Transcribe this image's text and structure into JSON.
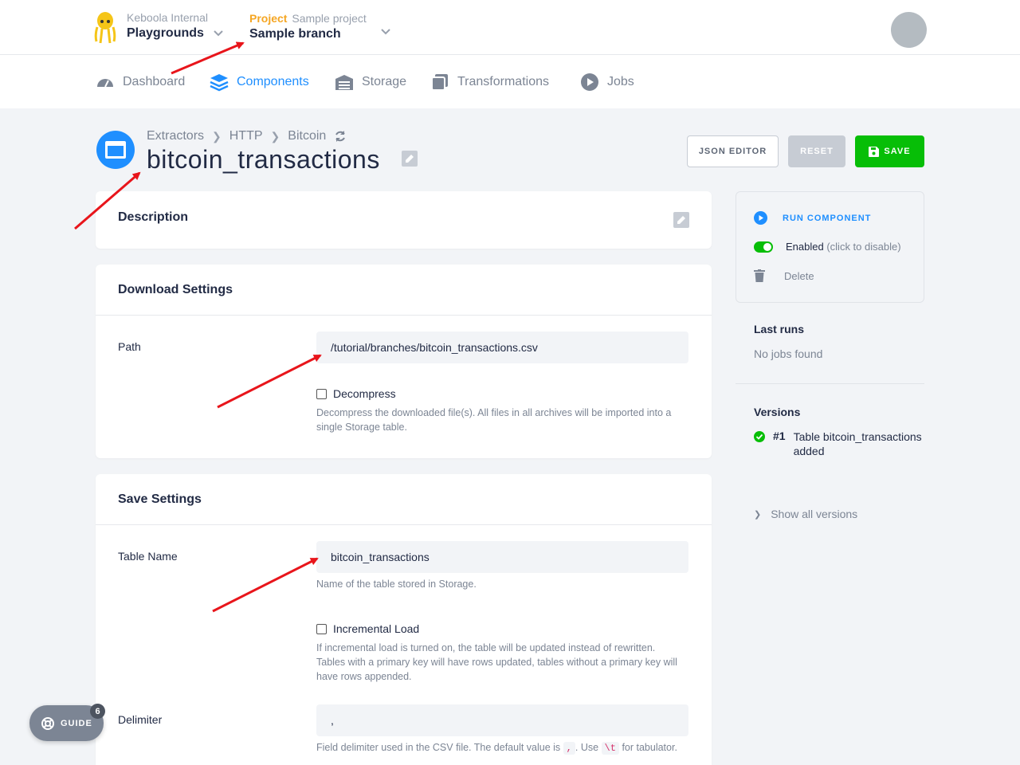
{
  "header": {
    "org_label": "Keboola Internal",
    "org_name": "Playgrounds",
    "project_prefix": "Project",
    "project_name": "Sample project",
    "branch_name": "Sample branch"
  },
  "nav": {
    "items": [
      {
        "label": "Dashboard",
        "icon": "gauge-icon"
      },
      {
        "label": "Components",
        "icon": "layers-icon"
      },
      {
        "label": "Storage",
        "icon": "warehouse-icon"
      },
      {
        "label": "Transformations",
        "icon": "copy-icon"
      },
      {
        "label": "Jobs",
        "icon": "play-circle-icon"
      }
    ],
    "active": "Components"
  },
  "page": {
    "breadcrumb": [
      "Extractors",
      "HTTP",
      "Bitcoin"
    ],
    "title": "bitcoin_transactions"
  },
  "actions": {
    "json_editor": "JSON EDITOR",
    "reset": "RESET",
    "save": "SAVE"
  },
  "description": {
    "title": "Description"
  },
  "download": {
    "title": "Download Settings",
    "path_label": "Path",
    "path_value": "/tutorial/branches/bitcoin_transactions.csv",
    "decompress_label": "Decompress",
    "decompress_help": "Decompress the downloaded file(s). All files in all archives will be imported into a single Storage table."
  },
  "save_settings": {
    "title": "Save Settings",
    "table_label": "Table Name",
    "table_value": "bitcoin_transactions",
    "table_help": "Name of the table stored in Storage.",
    "incremental_label": "Incremental Load",
    "incremental_help": "If incremental load is turned on, the table will be updated instead of rewritten. Tables with a primary key will have rows updated, tables without a primary key will have rows appended.",
    "delimiter_label": "Delimiter",
    "delimiter_value": ",",
    "delimiter_help_1": "Field delimiter used in the CSV file. The default value is",
    "delimiter_code_1": ",",
    "delimiter_help_2": ". Use",
    "delimiter_code_2": "\\t",
    "delimiter_help_3": "for tabulator."
  },
  "sidebar": {
    "run": "RUN COMPONENT",
    "enabled": "Enabled",
    "enabled_hint": "(click to disable)",
    "delete": "Delete",
    "last_runs_title": "Last runs",
    "last_runs_empty": "No jobs found",
    "versions_title": "Versions",
    "version_number": "#1",
    "version_text": "Table bitcoin_transactions added",
    "show_all": "Show all versions"
  },
  "guide": {
    "label": "GUIDE",
    "count": "6"
  },
  "colors": {
    "accent": "#1f8fff",
    "save": "#07be07",
    "arrow": "#e8151b",
    "brand": "#f5a623"
  }
}
